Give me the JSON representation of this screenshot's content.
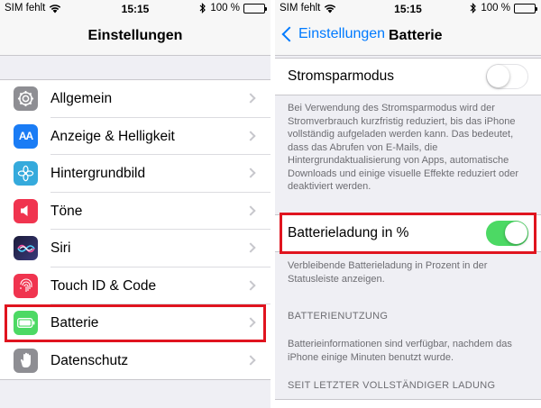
{
  "left_screen": {
    "status": {
      "carrier": "SIM fehlt",
      "time": "15:15",
      "battery_percent": "100 %"
    },
    "title": "Einstellungen",
    "items": [
      {
        "label": "Allgemein",
        "icon": "gear-icon",
        "color": "#8e8e93"
      },
      {
        "label": "Anzeige & Helligkeit",
        "icon": "text-size-icon",
        "glyph": "AA",
        "color": "#1a7cf5"
      },
      {
        "label": "Hintergrundbild",
        "icon": "flower-icon",
        "color": "#35aadc"
      },
      {
        "label": "Töne",
        "icon": "speaker-icon",
        "color": "#f0344f"
      },
      {
        "label": "Siri",
        "icon": "siri-icon",
        "color": "#2b2b5e"
      },
      {
        "label": "Touch ID & Code",
        "icon": "fingerprint-icon",
        "color": "#f0344f"
      },
      {
        "label": "Batterie",
        "icon": "battery-icon",
        "color": "#4cd964"
      },
      {
        "label": "Datenschutz",
        "icon": "hand-icon",
        "color": "#8e8e93"
      }
    ],
    "highlight_color": "#e0141f"
  },
  "right_screen": {
    "status": {
      "carrier": "SIM fehlt",
      "time": "15:15",
      "battery_percent": "100 %"
    },
    "back_label": "Einstellungen",
    "title": "Batterie",
    "power_saving": {
      "label": "Stromsparmodus",
      "on": false
    },
    "power_saving_note": "Bei Verwendung des Stromsparmodus wird der Stromverbrauch kurzfristig reduziert, bis das iPhone vollständig aufgeladen werden kann. Das bedeutet, dass das Abrufen von E-Mails, die Hintergrundaktualisierung von Apps, automatische Downloads und einige visuelle Effekte reduziert oder deaktiviert werden.",
    "battery_percentage": {
      "label": "Batterieladung in %",
      "on": true
    },
    "battery_percentage_note": "Verbleibende Batterieladung in Prozent in der Statusleiste anzeigen.",
    "usage_header": "BATTERIENUTZUNG",
    "usage_note": "Batterieinformationen sind verfügbar, nachdem das iPhone einige Minuten benutzt wurde.",
    "since_header": "SEIT LETZTER VOLLSTÄNDIGER LADUNG",
    "accent": "#007aff",
    "toggle_on_color": "#4cd964"
  }
}
